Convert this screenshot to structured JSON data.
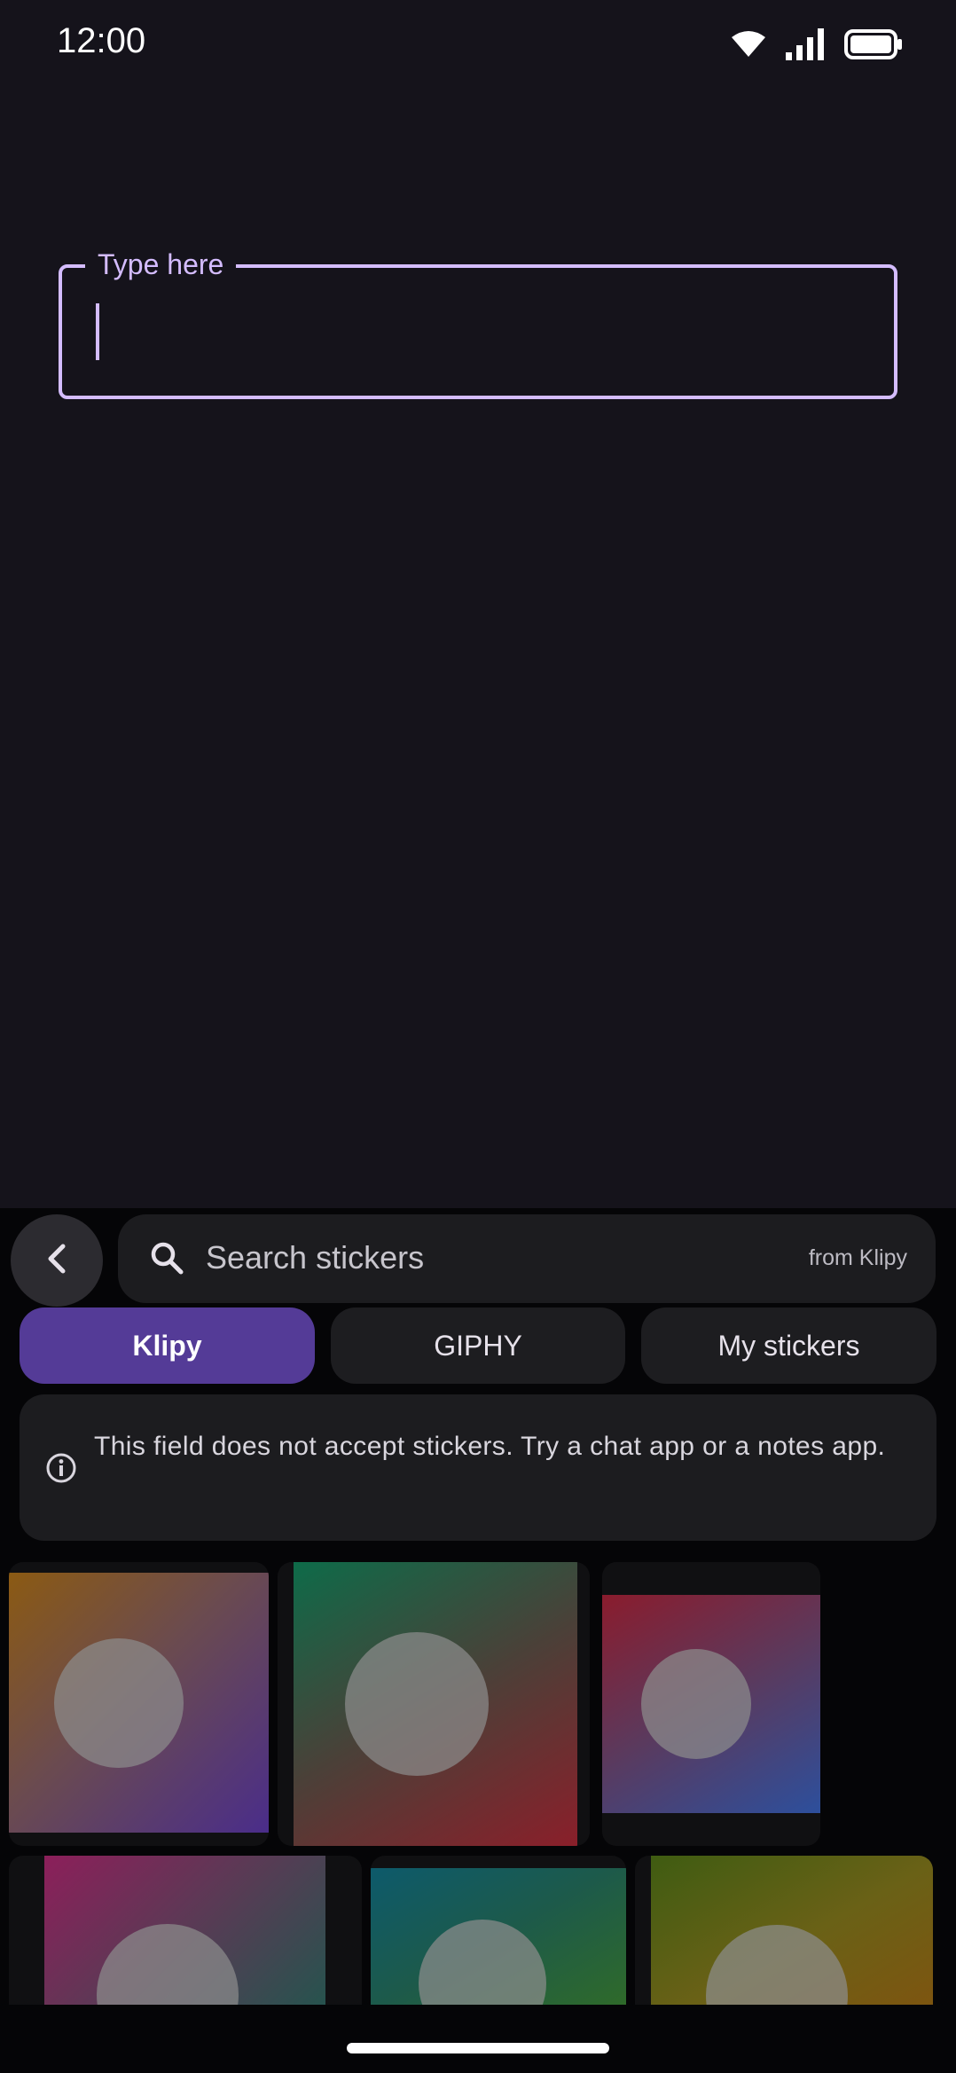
{
  "status_bar": {
    "time": "12:00",
    "icons": [
      "wifi-icon",
      "signal-icon",
      "battery-icon"
    ]
  },
  "text_field": {
    "label": "Type here",
    "value": ""
  },
  "sticker_panel": {
    "search": {
      "placeholder": "Search stickers",
      "source": "from Klipy"
    },
    "tabs": [
      {
        "label": "Klipy",
        "active": true
      },
      {
        "label": "GIPHY",
        "active": false
      },
      {
        "label": "My stickers",
        "active": false
      }
    ],
    "info_message": "This field does not accept stickers. Try a chat app or a notes app."
  },
  "colors": {
    "background": "#15131b",
    "accent": "#d4bcff",
    "active_tab": "#543b97",
    "panel": "#050507"
  }
}
